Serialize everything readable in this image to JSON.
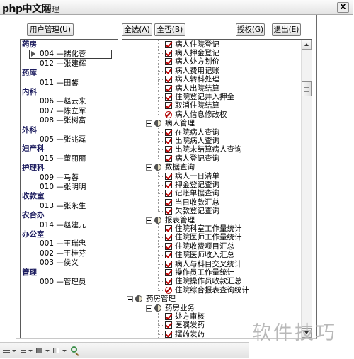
{
  "window": {
    "logo": "php中文网",
    "title": "管理",
    "close_label": "X"
  },
  "toolbar": {
    "user_management": "用户管理(U)",
    "select_all": "全选(A)",
    "select_none": "全否(B)",
    "grant": "授权(G)",
    "exit": "退出(E)"
  },
  "users": [
    {
      "label": "药房",
      "is_department": true
    },
    {
      "label": "004 —揣化蓉",
      "selected": true
    },
    {
      "label": "012 —张建辉"
    },
    {
      "label": "药库",
      "is_department": true
    },
    {
      "label": "011 —田馨"
    },
    {
      "label": "内科",
      "is_department": true
    },
    {
      "label": "006 —赵云来"
    },
    {
      "label": "007 —陈立军"
    },
    {
      "label": "008 —张树富"
    },
    {
      "label": "外科",
      "is_department": true
    },
    {
      "label": "005 —张兆磊"
    },
    {
      "label": "妇产科",
      "is_department": true
    },
    {
      "label": "015 —董丽丽"
    },
    {
      "label": "护理科",
      "is_department": true
    },
    {
      "label": "009 —马蓉"
    },
    {
      "label": "010 —张明明"
    },
    {
      "label": "收款室",
      "is_department": true
    },
    {
      "label": "013 —张永生"
    },
    {
      "label": "农合办",
      "is_department": true
    },
    {
      "label": "014 —赵建元"
    },
    {
      "label": "办公室",
      "is_department": true
    },
    {
      "label": "001 —王瑞忠"
    },
    {
      "label": "002 —王桂芬"
    },
    {
      "label": "003 —侯义"
    },
    {
      "label": "管理",
      "is_department": true
    },
    {
      "label": "000 —管理员"
    }
  ],
  "permissions": [
    {
      "label": "病人住院登记",
      "icon": "checked-box-icon"
    },
    {
      "label": "病人押金登记",
      "icon": "checked-box-icon"
    },
    {
      "label": "病人处方划价",
      "icon": "checked-box-icon"
    },
    {
      "label": "病人费用记账",
      "icon": "checked-box-icon"
    },
    {
      "label": "病人转科处理",
      "icon": "checked-box-icon"
    },
    {
      "label": "病人出院结算",
      "icon": "checked-box-icon"
    },
    {
      "label": "住院登记并入押金",
      "icon": "checked-box-icon"
    },
    {
      "label": "取消住院结算",
      "icon": "checked-box-icon"
    },
    {
      "label": "病人信息修改权",
      "icon": "denied-icon"
    },
    {
      "label": "病人管理",
      "icon": "tree-node-icon",
      "depth": 1,
      "expanded": true
    },
    {
      "label": "在院病人查询",
      "icon": "checked-box-icon"
    },
    {
      "label": "出院病人查询",
      "icon": "checked-box-icon"
    },
    {
      "label": "出院未结算病人查询",
      "icon": "checked-box-icon"
    },
    {
      "label": "病人登记查询",
      "icon": "checked-box-icon"
    },
    {
      "label": "数据查询",
      "icon": "tree-node-icon",
      "depth": 1,
      "expanded": true
    },
    {
      "label": "病人一日清单",
      "icon": "checked-box-icon"
    },
    {
      "label": "押金登记查询",
      "icon": "checked-box-icon"
    },
    {
      "label": "记账单据查询",
      "icon": "checked-box-icon"
    },
    {
      "label": "当日收款汇总",
      "icon": "checked-box-icon"
    },
    {
      "label": "欠款登记查询",
      "icon": "checked-box-icon"
    },
    {
      "label": "报表管理",
      "icon": "tree-node-icon",
      "depth": 1,
      "expanded": true
    },
    {
      "label": "住院科室工作量统计",
      "icon": "checked-box-icon"
    },
    {
      "label": "住院医师工作量统计",
      "icon": "checked-box-icon"
    },
    {
      "label": "住院收费项目汇总",
      "icon": "checked-box-icon"
    },
    {
      "label": "住院医师收入汇总",
      "icon": "checked-box-icon"
    },
    {
      "label": "病人与科目交叉统计",
      "icon": "checked-box-icon"
    },
    {
      "label": "操作员工作量统计",
      "icon": "checked-box-icon"
    },
    {
      "label": "住院操作员收款汇总",
      "icon": "checked-box-icon"
    },
    {
      "label": "住院综合报表查询统计",
      "icon": "denied-icon"
    },
    {
      "label": "药房管理",
      "icon": "tree-node-icon",
      "depth": 0,
      "expanded": true
    },
    {
      "label": "药房业务",
      "icon": "tree-node-icon",
      "depth": 1,
      "expanded": true
    },
    {
      "label": "处方审核",
      "icon": "checked-box-icon"
    },
    {
      "label": "医嘱发药",
      "icon": "checked-box-icon"
    },
    {
      "label": "摆药发药",
      "icon": "checked-box-icon"
    }
  ],
  "taskbar": {
    "icons": [
      "lines-icon",
      "dropdown-arrow-icon",
      "indent-icon",
      "dropdown-arrow-icon",
      "block-icon",
      "dropdown-arrow-icon",
      "layout-icon",
      "dropdown-arrow-icon",
      "zoom-icon"
    ]
  },
  "watermark": "软件技巧",
  "colors": {
    "department_header": "#1e1e60",
    "check_mark": "#c00000",
    "denied": "#b00000",
    "watermark": "#b9b9b9"
  }
}
